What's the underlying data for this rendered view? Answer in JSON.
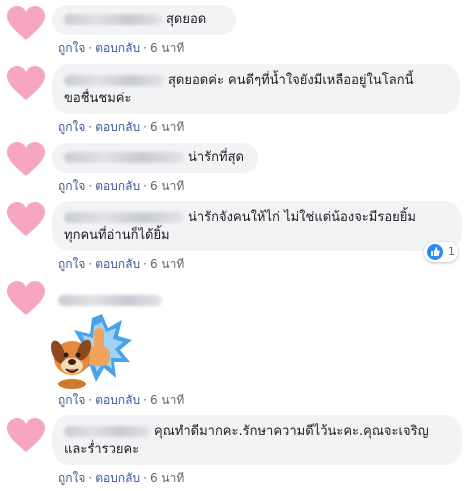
{
  "actions": {
    "like": "ถูกใจ",
    "reply": "ตอบกลับ",
    "separator": "·",
    "time": "6 นาที"
  },
  "comments": [
    {
      "text": "สุดยอด"
    },
    {
      "line1": "สุดยอดค่ะ คนดีๆที่น้ำใจยังมีเหลืออยู่ในโลกนี้",
      "line2": "ขอชื่นชมค่ะ"
    },
    {
      "text": "น่ารักที่สุด"
    },
    {
      "line1": "น่ารักจังคนให้ไก่ ไม่ใช่แต่น้องจะมีรอยยิ้ม",
      "line2": "ทุกคนที่อ่านก็ได้ยิ้ม",
      "reaction_count": "1"
    },
    {
      "sticker": "dog-thumbs-up-sticker"
    },
    {
      "line1": "คุณทำดีมากคะ.รักษาความดีไว้นะคะ.คุณจะเจริญ",
      "line2": "และร่ำรวยคะ"
    }
  ],
  "colors": {
    "avatar": "#f7a6c0",
    "bubble": "#f2f3f5",
    "link": "#385898",
    "meta": "#606770",
    "like": "#2d88ff"
  },
  "icons": [
    "heart-avatar-icon",
    "like-reaction-icon"
  ]
}
